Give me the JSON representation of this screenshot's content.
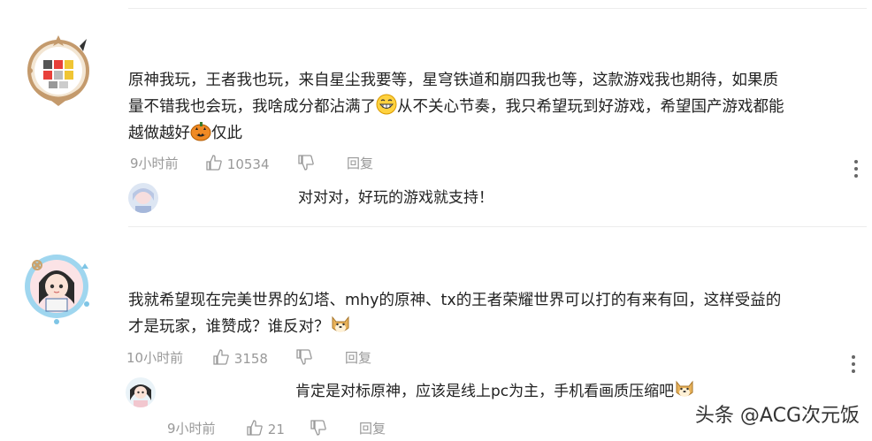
{
  "comments": [
    {
      "lines": [
        "原神我玩，王者我也玩，来自星尘我要等，星穹铁道和崩四我也等，这款游戏我也期待，如果质",
        "量不错我也会玩，我啥成分都沾满了",
        "从不关心节奏，我只希望玩到好游戏，希望国产游戏都能",
        "越做越好",
        "仅此"
      ],
      "time": "9小时前",
      "likes": "10534",
      "reply_label": "回复",
      "reply": {
        "text": "对对对，好玩的游戏就支持！"
      }
    },
    {
      "lines": [
        "我就希望现在完美世界的幻塔、mhy的原神、tx的王者荣耀世界可以打的有来有回，这样受益的",
        "才是玩家，谁赞成？谁反对？"
      ],
      "time": "10小时前",
      "likes": "3158",
      "reply_label": "回复",
      "reply": {
        "text": "肯定是对标原神，应该是线上pc为主，手机看画质压缩吧",
        "time": "9小时前",
        "likes": "21",
        "reply_label": "回复"
      }
    }
  ],
  "watermark": "头条 @ACG次元饭",
  "icons": {
    "like": "thumbs-up-icon",
    "dislike": "thumbs-down-icon",
    "more": "more-vertical-icon",
    "emoji_grin": "grinning-emoji-icon",
    "emoji_pumpkin": "pumpkin-emoji-icon",
    "emoji_doge": "doge-emoji-icon"
  },
  "colors": {
    "meta": "#999999",
    "text": "#222222",
    "divider": "#ececec"
  }
}
